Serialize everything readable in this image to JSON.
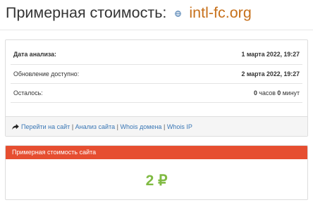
{
  "header": {
    "title": "Примерная стоимость:",
    "domain": "intl-fc.org",
    "domain_icon": "globe-icon"
  },
  "info_panel": {
    "rows": [
      {
        "label": "Дата анализа:",
        "value": "1 марта 2022, 19:27"
      },
      {
        "label": "Обновление доступно:",
        "value": "2 марта 2022, 19:27"
      },
      {
        "label": "Осталось:",
        "value_parts": [
          "0",
          " часов ",
          "0",
          " минут"
        ]
      }
    ],
    "footer": {
      "icon": "share-arrow-icon",
      "links": [
        "Перейти на сайт",
        "Анализ сайта",
        "Whois домена",
        "Whois IP"
      ],
      "separator": "|"
    }
  },
  "value_panel": {
    "heading": "Примерная стоимость сайта",
    "value": "2 ₽"
  },
  "colors": {
    "domain": "#c7711c",
    "link": "#3a77b5",
    "heading_bg": "#e64e30",
    "value": "#7fba42"
  }
}
